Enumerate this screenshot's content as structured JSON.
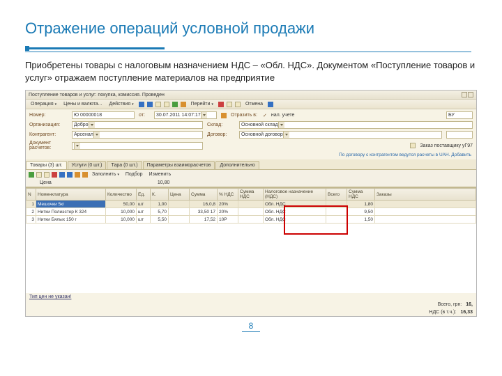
{
  "slide": {
    "title": "Отражение операций условной продажи",
    "description": "Приобретены товары с налоговым назначением НДС – «Обл. НДС». Документом «Поступление товаров и услуг» отражаем поступление материалов на предприятие",
    "page": "8"
  },
  "app": {
    "window_title": "Поступление товаров и услуг: покупка, комиссия. Проведен",
    "toolbar": {
      "actions": "Операция",
      "menu2": "Цены и валюта...",
      "menu3": "Действия",
      "go": "Перейти",
      "cancel": "Отмена"
    },
    "form": {
      "number_lbl": "Номер:",
      "number_val": "Ю 00000018",
      "date_lbl": "от:",
      "date_val": "30.07.2011 14:07:17",
      "refl_lbl": "Отразить в:",
      "nal_lbl": "нал. учете",
      "org_lbl": "Организация:",
      "org_val": "Добро",
      "sklad_lbl": "Склад:",
      "sklad_val": "Основной склад",
      "kontr_lbl": "Контрагент:",
      "kontr_val": "Арсенал",
      "dogovor_lbl": "Договор:",
      "dogovor_val": "Основной договор",
      "dokument_lbl": "Документ расчетов:",
      "dokument_val": "Заказ поставщику уГ97",
      "hint": "По договору с контрагентом ведутся расчеты в UAH. Добавить"
    },
    "tabs": [
      "Товары (3) шт.",
      "Услуги (0 шт.)",
      "Тара (0 шт.)",
      "Параметры взаиморасчетов",
      "Дополнительно"
    ],
    "subtoolbar": {
      "fill": "Заполнить",
      "sel": "Подбор",
      "change": "Изменить"
    },
    "price": {
      "lbl": "Цена",
      "val": "10,80"
    },
    "table": {
      "cols": [
        "N",
        "Номенклатура",
        "Количество",
        "Ед.",
        "К.",
        "Цена",
        "Сумма",
        "% НДС",
        "Сумма НДС",
        "Налоговое назначение (НДС)",
        "Всего",
        "Сумма НДС",
        "Заказы"
      ],
      "rows": [
        {
          "n": "1",
          "nom": "Мешочки 5кг",
          "qty": "50,00",
          "ed": "шт",
          "k": "1,00",
          "price": "",
          "sum": "16,0,8",
          "pds": "20%",
          "snds": "",
          "nazn": "Обл. НДС",
          "vsego": "",
          "sumnds": "1,80",
          "zak": ""
        },
        {
          "n": "2",
          "nom": "Нитки Полиэстер К 324",
          "qty": "10,000",
          "ed": "шт",
          "k": "5,70",
          "price": "",
          "sum": "33,50 17",
          "pds": "20%",
          "snds": "",
          "nazn": "Обл. НДС",
          "vsego": "",
          "sumnds": "9,50",
          "zak": ""
        },
        {
          "n": "3",
          "nom": "Нитки Бялых 150 г",
          "qty": "10,000",
          "ed": "шт",
          "k": "5,50",
          "price": "",
          "sum": "17,52",
          "pds": "10Р",
          "snds": "",
          "nazn": "Обл. НДС",
          "vsego": "",
          "sumnds": "1,50",
          "zak": ""
        }
      ]
    },
    "footer": {
      "link": "Тип цен не указан!",
      "total_lbl": "Всего, грн:",
      "total_val": "16,",
      "nds_lbl": "НДС (в т.ч.):",
      "nds_val": "16,33"
    }
  }
}
